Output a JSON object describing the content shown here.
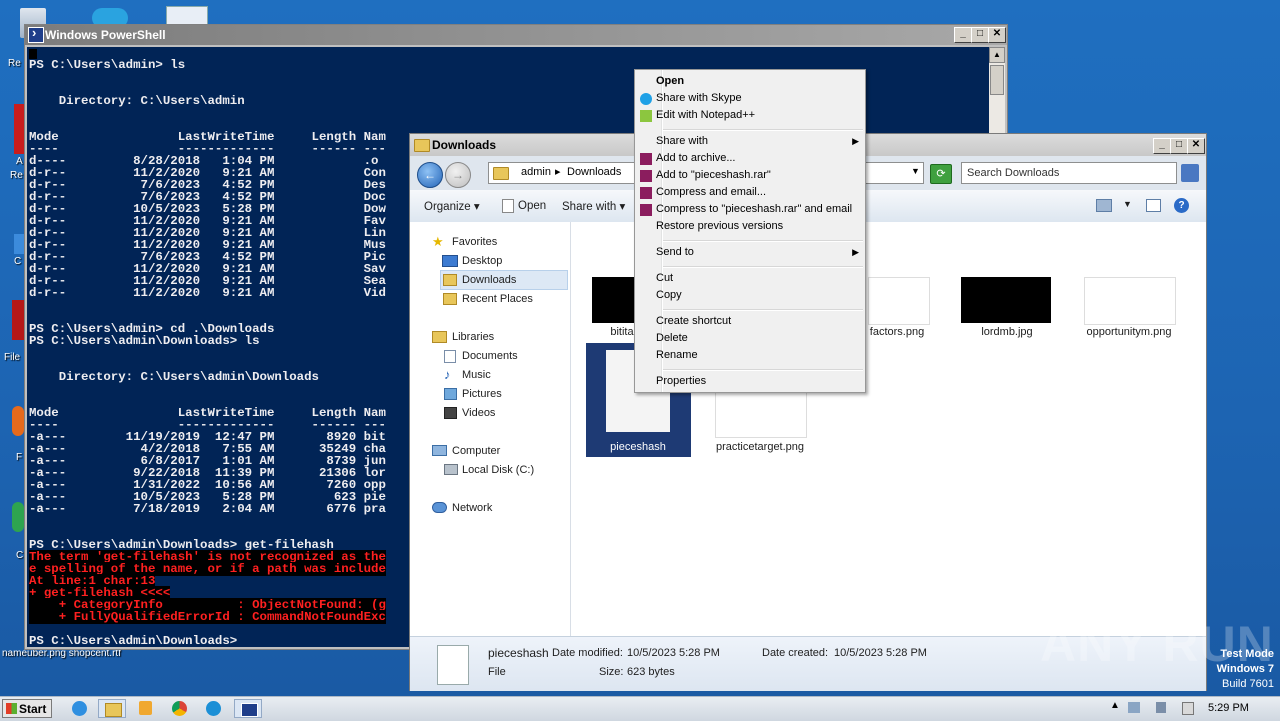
{
  "powershell": {
    "title": "Windows PowerShell",
    "lines": [
      "",
      "PS C:\\Users\\admin> ls",
      "",
      "",
      "    Directory: C:\\Users\\admin",
      "",
      "",
      "Mode                LastWriteTime     Length Nam",
      "----                -------------     ------ ---",
      "d----         8/28/2018   1:04 PM            .o",
      "d-r--         11/2/2020   9:21 AM            Con",
      "d-r--          7/6/2023   4:52 PM            Des",
      "d-r--          7/6/2023   4:52 PM            Doc",
      "d-r--         10/5/2023   5:28 PM            Dow",
      "d-r--         11/2/2020   9:21 AM            Fav",
      "d-r--         11/2/2020   9:21 AM            Lin",
      "d-r--         11/2/2020   9:21 AM            Mus",
      "d-r--          7/6/2023   4:52 PM            Pic",
      "d-r--         11/2/2020   9:21 AM            Sav",
      "d-r--         11/2/2020   9:21 AM            Sea",
      "d-r--         11/2/2020   9:21 AM            Vid",
      "",
      "",
      "PS C:\\Users\\admin> cd .\\Downloads",
      "PS C:\\Users\\admin\\Downloads> ls",
      "",
      "",
      "    Directory: C:\\Users\\admin\\Downloads",
      "",
      "",
      "Mode                LastWriteTime     Length Nam",
      "----                -------------     ------ ---",
      "-a---        11/19/2019  12:47 PM       8920 bit",
      "-a---          4/2/2018   7:55 AM      35249 cha",
      "-a---          6/8/2017   1:01 AM       8739 jun",
      "-a---         9/22/2018  11:39 PM      21306 lor",
      "-a---         1/31/2022  10:56 AM       7260 opp",
      "-a---         10/5/2023   5:28 PM        623 pie",
      "-a---         7/18/2019   2:04 AM       6776 pra",
      "",
      "",
      "PS C:\\Users\\admin\\Downloads> get-filehash"
    ],
    "error_lines": [
      "The term 'get-filehash' is not recognized as the",
      "e spelling of the name, or if a path was include",
      "At line:1 char:13",
      "+ get-filehash <<<<",
      "    + CategoryInfo          : ObjectNotFound: (g",
      "    + FullyQualifiedErrorId : CommandNotFoundExc"
    ],
    "prompt_after": "PS C:\\Users\\admin\\Downloads> "
  },
  "explorer": {
    "title": "Downloads",
    "breadcrumb": [
      "admin",
      "Downloads"
    ],
    "search_placeholder": "Search Downloads",
    "toolbar": {
      "organize": "Organize",
      "open": "Open",
      "share_with": "Share with"
    },
    "nav": {
      "favorites": "Favorites",
      "desktop": "Desktop",
      "downloads": "Downloads",
      "recent": "Recent Places",
      "libraries": "Libraries",
      "documents": "Documents",
      "music": "Music",
      "pictures": "Pictures",
      "videos": "Videos",
      "computer": "Computer",
      "local_disk": "Local Disk (C:)",
      "network": "Network"
    },
    "files": [
      {
        "name": "bitita",
        "kind": "dark"
      },
      {
        "name": "factors.png",
        "kind": "white"
      },
      {
        "name": "lordmb.jpg",
        "kind": "dark"
      },
      {
        "name": "opportunitym.png",
        "kind": "white"
      },
      {
        "name": "pieceshash",
        "kind": "selected"
      },
      {
        "name": "practicetarget.png",
        "kind": "white"
      }
    ],
    "details": {
      "name": "pieceshash",
      "type": "File",
      "modified_label": "Date modified:",
      "modified": "10/5/2023 5:28 PM",
      "created_label": "Date created:",
      "created": "10/5/2023 5:28 PM",
      "size_label": "Size:",
      "size": "623 bytes"
    }
  },
  "context_menu": {
    "items": [
      {
        "label": "Open",
        "bold": true
      },
      {
        "label": "Share with Skype",
        "icon": "skype"
      },
      {
        "label": "Edit with Notepad++",
        "icon": "notepad"
      },
      {
        "sep": true
      },
      {
        "label": "Share with",
        "arrow": true
      },
      {
        "label": "Add to archive...",
        "icon": "rar"
      },
      {
        "label": "Add to \"pieceshash.rar\"",
        "icon": "rar"
      },
      {
        "label": "Compress and email...",
        "icon": "rar"
      },
      {
        "label": "Compress to \"pieceshash.rar\" and email",
        "icon": "rar"
      },
      {
        "label": "Restore previous versions"
      },
      {
        "sep": true
      },
      {
        "label": "Send to",
        "arrow": true
      },
      {
        "sep": true
      },
      {
        "label": "Cut"
      },
      {
        "label": "Copy"
      },
      {
        "sep": true
      },
      {
        "label": "Create shortcut"
      },
      {
        "label": "Delete"
      },
      {
        "label": "Rename"
      },
      {
        "sep": true
      },
      {
        "label": "Properties"
      }
    ]
  },
  "desktop": {
    "partial_labels": [
      "Re",
      "A",
      "Re",
      "C",
      "File",
      "F",
      "C",
      "nameuber.png shopcent.rtf"
    ]
  },
  "taskbar": {
    "start": "Start",
    "time": "5:29 PM"
  },
  "watermark": "ANY RUN",
  "test_mode": [
    "Test Mode",
    "Windows 7",
    "Build 7601"
  ]
}
